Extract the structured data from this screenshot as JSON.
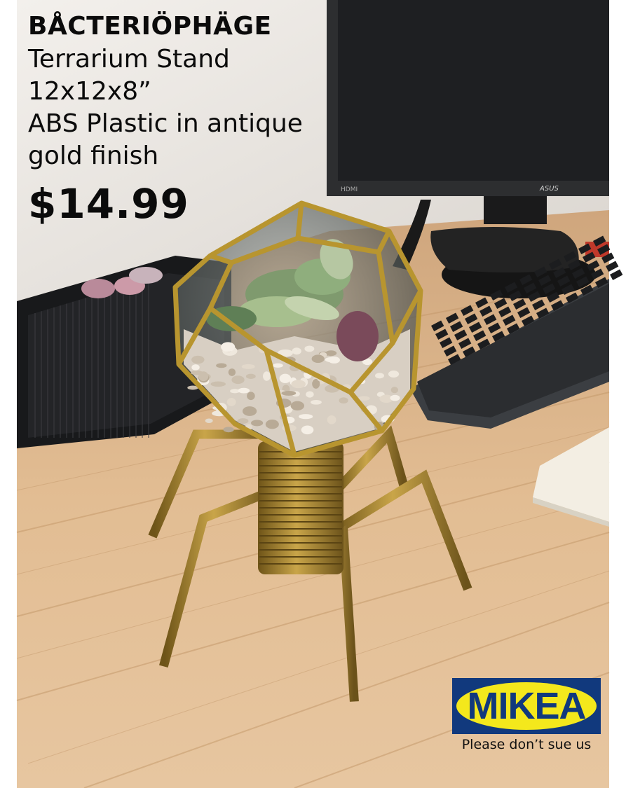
{
  "product": {
    "name": "BÅCTERIÖPHÄGE",
    "lines": [
      "Terrarium Stand",
      "12x12x8”",
      "ABS Plastic in antique",
      "gold finish"
    ],
    "price": "$14.99"
  },
  "logo": {
    "wordmark": "MIKEA",
    "tagline": "Please don’t sue us",
    "colors": {
      "background": "#11397d",
      "oval": "#f4e81c"
    }
  },
  "monitor": {
    "brand_text": "ASUS",
    "port_label": "HDMI"
  },
  "colors": {
    "wall": "#ece8e4",
    "desk": "#dcb488",
    "gold": "#a8842e",
    "text": "#0b0b0b"
  }
}
